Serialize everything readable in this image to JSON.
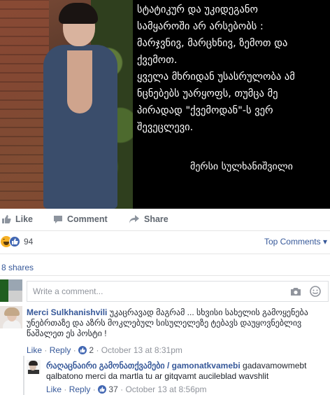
{
  "post": {
    "quote_text": "სტატიკურ და უკიდეგანო\nსამყაროში არ არსებობს :\nმარჯვნივ, მარცხნივ, ზემოთ და\nქვემოთ.\nყველა მხრიდან უსასრულობა ამ\nნცნებებს უარყოფს, თუმცა მე\nპირადად \"ქვემოდან\"-ს ვერ\nშევეცლევი.",
    "signature": "მერსი სულხანიშვილი"
  },
  "actions": {
    "like_label": "Like",
    "comment_label": "Comment",
    "share_label": "Share"
  },
  "reactions": {
    "count": "94",
    "top_comments_label": "Top Comments ▾"
  },
  "shares": {
    "label": "8 shares"
  },
  "composer": {
    "placeholder": "Write a comment..."
  },
  "comments": [
    {
      "author": "Merci Sulkhanishvili",
      "text": "უკაცრავად მაგრამ ... სხვისი სახელის გამოყენება უნებრთაზე და აზრს მოკლებულ სისულელეზე ტებავს დაუყოვნებლივ წაშალეთ ეს პოსტი !",
      "like_label": "Like",
      "reply_label": "Reply",
      "like_count": "2",
      "time": "October 13 at 8:31pm"
    },
    {
      "author": "რაღაცნაირი გამონათქვამები / gamonatkvamebi",
      "text": "gadavamowmebt qalbatono merci da martla tu ar gitqvamt aucileblad wavshlit",
      "like_label": "Like",
      "reply_label": "Reply",
      "like_count": "37",
      "time": "October 13 at 8:56pm"
    }
  ],
  "colors": {
    "link": "#365899",
    "meta": "#90949c",
    "like_blue": "#4267b2",
    "haha_yellow": "#f7b125"
  }
}
